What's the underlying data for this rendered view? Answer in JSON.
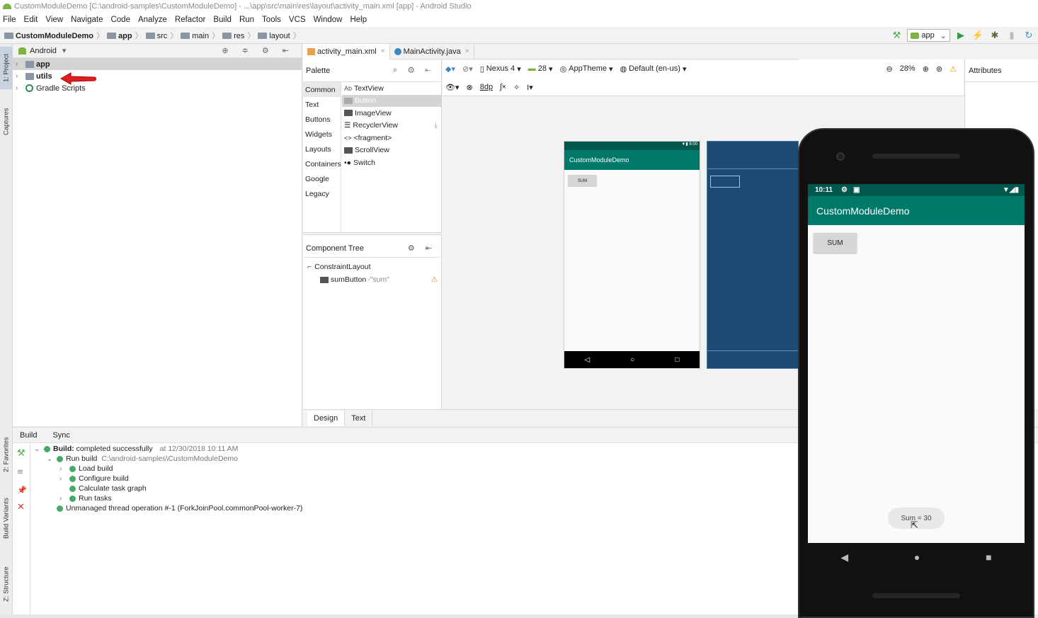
{
  "window": {
    "title": "CustomModuleDemo [C:\\android-samples\\CustomModuleDemo] - ...\\app\\src\\main\\res\\layout\\activity_main.xml [app] - Android Studio"
  },
  "menu": [
    "File",
    "Edit",
    "View",
    "Navigate",
    "Code",
    "Analyze",
    "Refactor",
    "Build",
    "Run",
    "Tools",
    "VCS",
    "Window",
    "Help"
  ],
  "breadcrumb": [
    "CustomModuleDemo",
    "app",
    "src",
    "main",
    "res",
    "layout"
  ],
  "run_config": "app",
  "left_strip": {
    "project": "1: Project",
    "captures": "Captures",
    "favorites": "2: Favorites",
    "build_variants": "Build Variants",
    "structure": "Z: Structure"
  },
  "project": {
    "view_mode": "Android",
    "items": [
      {
        "label": "app",
        "bold": true
      },
      {
        "label": "utils",
        "bold": true
      },
      {
        "label": "Gradle Scripts",
        "bold": false
      }
    ]
  },
  "editor_tabs": [
    {
      "label": "activity_main.xml"
    },
    {
      "label": "MainActivity.java"
    }
  ],
  "palette": {
    "title": "Palette",
    "categories": [
      "Common",
      "Text",
      "Buttons",
      "Widgets",
      "Layouts",
      "Containers",
      "Google",
      "Legacy"
    ],
    "items": [
      "TextView",
      "Button",
      "ImageView",
      "RecyclerView",
      "<fragment>",
      "ScrollView",
      "Switch"
    ],
    "item_icons": [
      "Ab",
      "",
      "",
      "",
      "<>",
      "",
      ""
    ]
  },
  "component_tree": {
    "title": "Component Tree",
    "root": "ConstraintLayout",
    "child_name": "sumButton",
    "child_text": "\"sum\""
  },
  "design_toolbar": {
    "device": "Nexus 4",
    "api": "28",
    "theme": "AppTheme",
    "locale": "Default (en-us)",
    "zoom": "28%",
    "margin": "8dp"
  },
  "attributes_title": "Attributes",
  "bottom_tabs": [
    "Design",
    "Text"
  ],
  "preview": {
    "status": "8:00",
    "app_title": "CustomModuleDemo",
    "button": "SUM"
  },
  "build": {
    "tabs": [
      "Build",
      "Sync"
    ],
    "rows": [
      {
        "label": "Build:",
        "text": "completed successfully",
        "meta": "at 12/30/2018 10:11 AM"
      },
      {
        "label": "Run build",
        "meta": "C:\\android-samples\\CustomModuleDemo"
      },
      {
        "label": "Load build"
      },
      {
        "label": "Configure build"
      },
      {
        "label": "Calculate task graph"
      },
      {
        "label": "Run tasks"
      },
      {
        "label": "Unmanaged thread operation #-1 (ForkJoinPool.commonPool-worker-7)"
      }
    ]
  },
  "emulator": {
    "time": "10:11",
    "app_title": "CustomModuleDemo",
    "button": "SUM",
    "toast": "Sum = 30"
  },
  "colors": {
    "primary": "#00796b",
    "primary_dark": "#00574b",
    "blueprint": "#1c4a73",
    "arrow": "#e02020"
  }
}
